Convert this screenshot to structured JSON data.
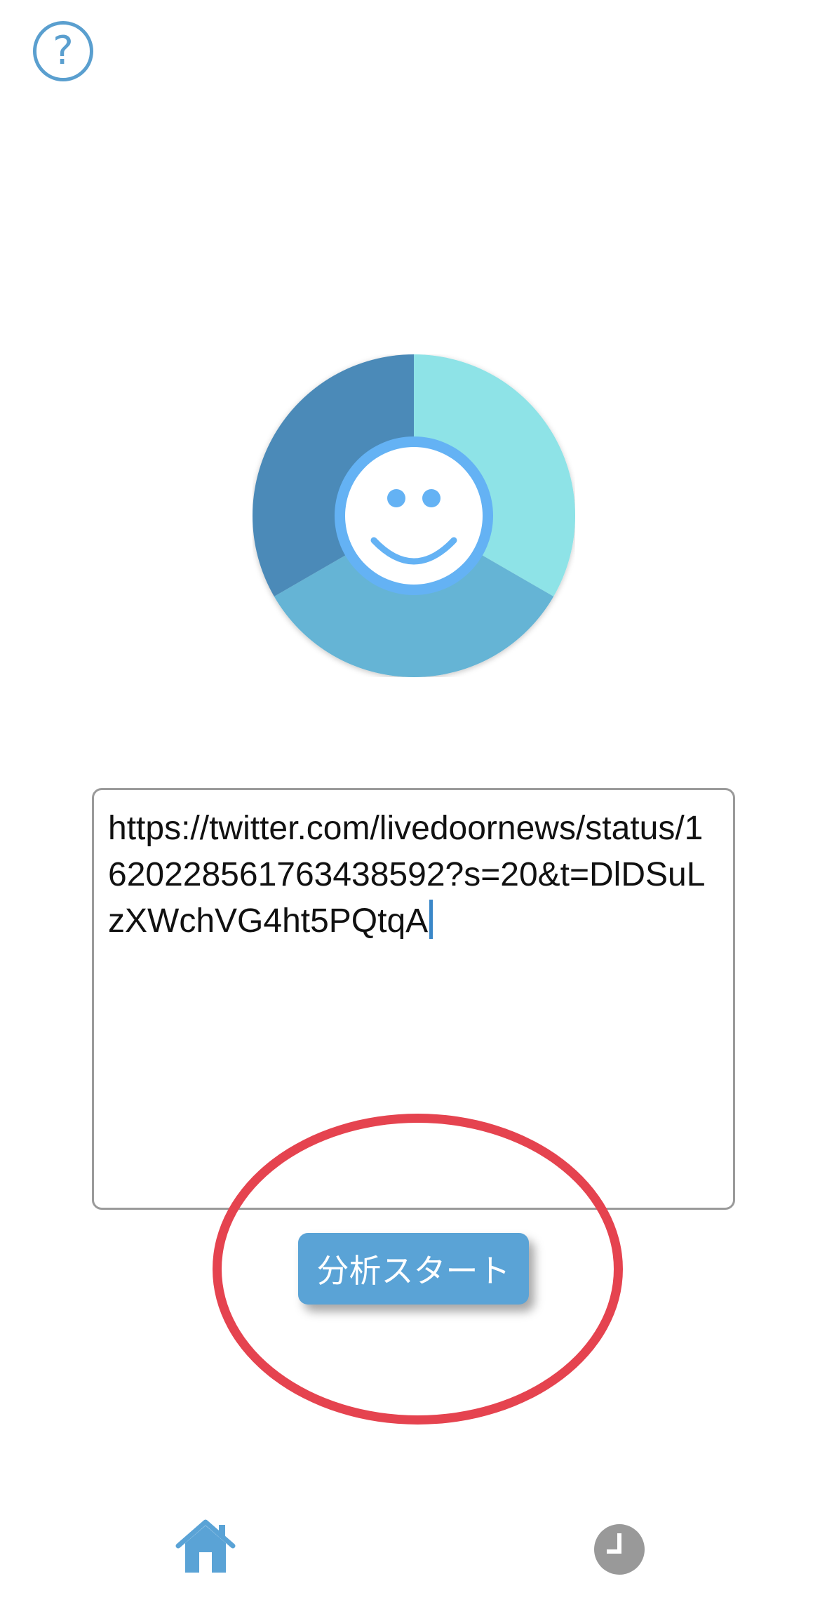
{
  "header": {
    "help_icon": "question-mark-icon",
    "help_glyph": "?"
  },
  "logo": {
    "icon": "smiley-face-icon",
    "colors": {
      "segment_1": "#8ee3e7",
      "segment_2": "#65b4d5",
      "segment_3": "#4b8ab8",
      "face_ring": "#64b2f4",
      "face_fill": "#ffffff"
    }
  },
  "url_input": {
    "value": "https://twitter.com/livedoornews/status/1620228561763438592?s=20&t=DlDSuLzXWchVG4ht5PQtqA"
  },
  "start_button": {
    "label": "分析スタート",
    "color": "#5aa3d6"
  },
  "highlight": {
    "color": "#e5434f"
  },
  "tab_bar": {
    "home_icon": "home-icon",
    "home_color": "#5aa3d6",
    "history_icon": "clock-icon",
    "history_color": "#999999"
  }
}
